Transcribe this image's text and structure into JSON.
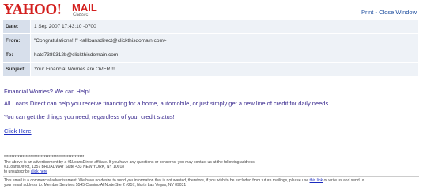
{
  "brand": {
    "yahoo": "YAHOO!",
    "mail": "MAIL",
    "edition": "Classic",
    "color": "#d3201f"
  },
  "toolbar": {
    "print": "Print",
    "sep": " - ",
    "close": "Close Window"
  },
  "header": {
    "date_label": "Date:",
    "date_value": "1 Sep 2007 17:43:10 -0700",
    "from_label": "From:",
    "from_value": "\"Congratulations!!!\" <allloansdirect@clickthisdomain.com>",
    "to_label": "To:",
    "to_value": "hatd7389312b@clickthisdomain.com",
    "subject_label": "Subject:",
    "subject_value": "Your Financial Worries are OVER!!!"
  },
  "message": {
    "line1": "Financial Worries? We can Help!",
    "line2": "All Loans Direct can help you receive financing for a home, automobile, or just simply get a new line of credit for daily needs",
    "line3": "You can get the things you need, regardless of your credit status!",
    "link": "Click Here"
  },
  "disclaimer": {
    "stars": "****************************************************",
    "line1": "The above is an advertisement by a #1LoansDirect affiliate. If you have any questions or concerns, you may contact us at the following address",
    "line2": "#1LoansDirect, 1357 BROADWAY Suite 433 NEW YORK, NY 10018",
    "line3_prefix": "to unsubscribe ",
    "line3_link": "click here"
  },
  "footer": {
    "line1_prefix": "This email is a commercial advertisement. We have no desire to send you information that is not wanted, therefore, if you wish to be excluded from future mailings, please use ",
    "line1_link": "this link",
    "line1_suffix": " or write us and send us",
    "line2": "your email address to: Member Services 5545 Camino Al Norte Ste 2 #257, North Las Vegas, NV 89031"
  }
}
